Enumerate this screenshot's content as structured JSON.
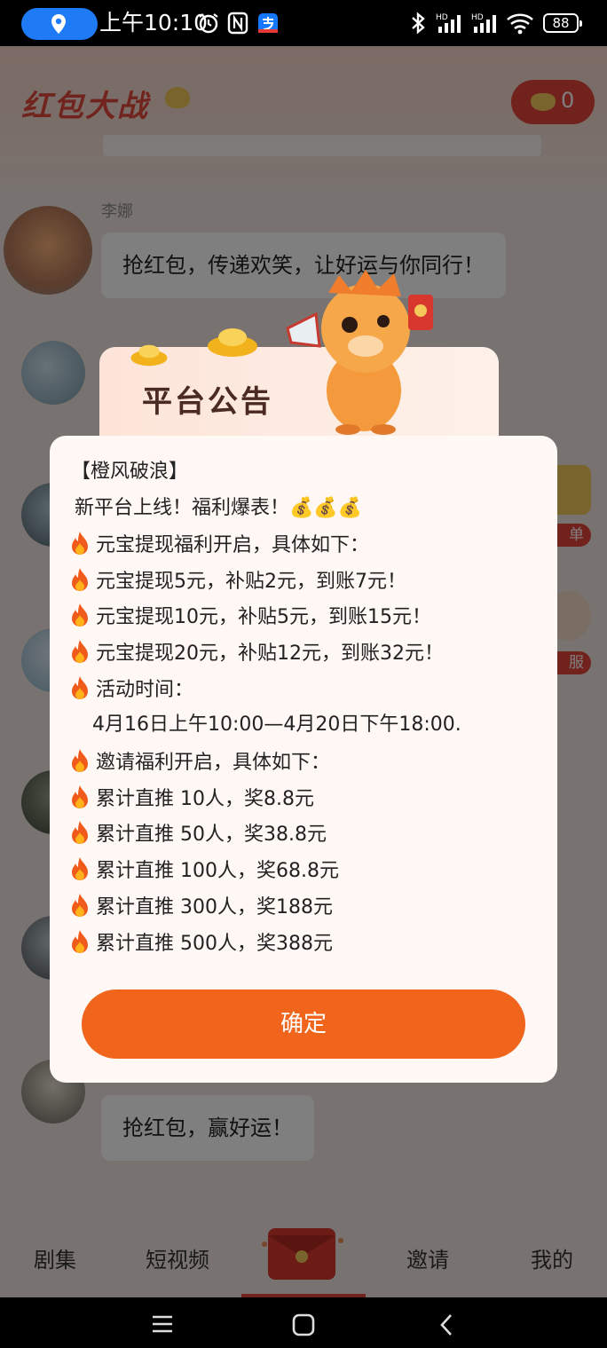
{
  "status_bar": {
    "time": "上午10:10",
    "battery": "88",
    "icons": [
      "location-icon",
      "alarm-icon",
      "nfc-icon",
      "alipay-icon",
      "bluetooth-icon",
      "hd-signal-icon",
      "hd-signal-icon",
      "wifi-icon",
      "battery-icon"
    ]
  },
  "header": {
    "logo_text": "红包大战",
    "coin_count": "0"
  },
  "chat": {
    "messages": [
      {
        "sender": "李娜",
        "text": "抢红包，传递欢笑，让好运与你同行！"
      },
      {
        "sender": "",
        "text": "抢红包，赢好运！"
      }
    ]
  },
  "side_buttons": [
    "单",
    "服"
  ],
  "notice": {
    "title": "平台公告",
    "lines": [
      {
        "fire": false,
        "text": "【橙风破浪】"
      },
      {
        "fire": false,
        "text": "新平台上线！福利爆表！💰💰💰"
      },
      {
        "fire": true,
        "text": "元宝提现福利开启，具体如下："
      },
      {
        "fire": true,
        "text": "元宝提现5元，补贴2元，到账7元！"
      },
      {
        "fire": true,
        "text": "元宝提现10元，补贴5元，到账15元！"
      },
      {
        "fire": true,
        "text": "元宝提现20元，补贴12元，到账32元！"
      },
      {
        "fire": true,
        "text": "活动时间："
      },
      {
        "fire": false,
        "text": "4月16日上午10:00—4月20日下午18:00."
      },
      {
        "fire": true,
        "text": "邀请福利开启，具体如下："
      },
      {
        "fire": true,
        "text": "累计直推 10人，奖8.8元"
      },
      {
        "fire": true,
        "text": "累计直推 50人，奖38.8元"
      },
      {
        "fire": true,
        "text": "累计直推 100人，奖68.8元"
      },
      {
        "fire": true,
        "text": "累计直推 300人，奖188元"
      },
      {
        "fire": true,
        "text": "累计直推 500人，奖388元"
      }
    ],
    "confirm_label": "确定"
  },
  "tabs": [
    "剧集",
    "短视频",
    "邀请",
    "我的"
  ],
  "colors": {
    "accent": "#f0641c",
    "brand_red": "#e5453a",
    "popup_bg": "#fff8f4"
  }
}
